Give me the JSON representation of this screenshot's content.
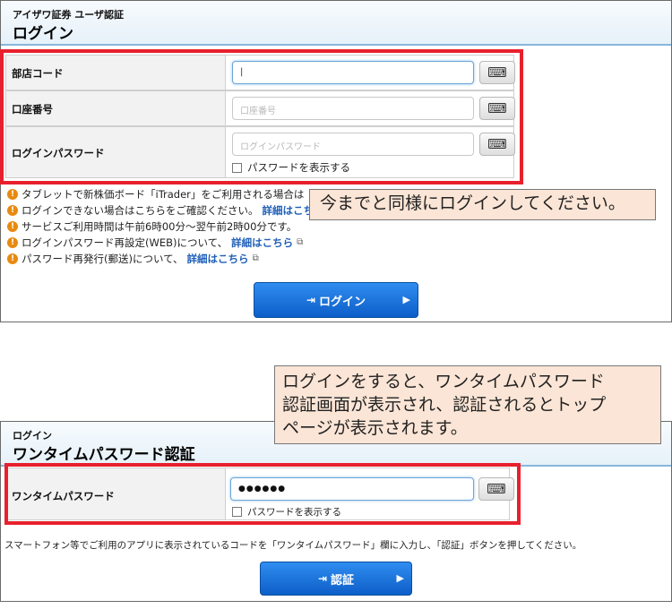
{
  "login": {
    "subtitle": "アイザワ証券 ユーザ認証",
    "title": "ログイン",
    "fields": [
      {
        "label": "部店コード",
        "value": "|",
        "placeholder": ""
      },
      {
        "label": "口座番号",
        "placeholder": "口座番号"
      },
      {
        "label": "ログインパスワード",
        "placeholder": "ログインパスワード"
      }
    ],
    "show_password": "パスワードを表示する",
    "notices": [
      {
        "text": "タブレットで新株価ボード「iTrader」をご利用される場合は",
        "link": ""
      },
      {
        "text": "ログインできない場合はこちらをご確認ください。",
        "link": "詳細はこち"
      },
      {
        "text": "サービスご利用時間は午前6時00分～翌午前2時00分です。",
        "link": ""
      },
      {
        "text": "ログインパスワード再設定(WEB)について、",
        "link": "詳細はこちら"
      },
      {
        "text": "パスワード再発行(郵送)について、",
        "link": "詳細はこちら"
      }
    ],
    "button": "ログイン",
    "callout": "今までと同様にログインしてください。"
  },
  "otp": {
    "subtitle": "ログイン",
    "title": "ワンタイムパスワード認証",
    "label": "ワンタイムパスワード",
    "value": "●●●●●●",
    "show_password": "パスワードを表示する",
    "instruction": "スマートフォン等でご利用のアプリに表示されているコードを「ワンタイムパスワード」欄に入力し、「認証」ボタンを押してください。",
    "button": "認証",
    "callout_lines": [
      "ログインをすると、ワンタイムパスワード",
      "認証画面が表示され、認証されるとトップ",
      "ページが表示されます。"
    ]
  },
  "icons": {
    "keyboard": "keyboard-icon",
    "warning": "warning-icon",
    "external": "external-link-icon",
    "login": "login-icon",
    "arrow": "arrow-right-icon"
  },
  "colors": {
    "highlight_border": "#e8202d",
    "button": "#0d5ec8",
    "callout_bg": "#fbe5d6",
    "link": "#1f5fb8",
    "warning": "#e88a10"
  }
}
